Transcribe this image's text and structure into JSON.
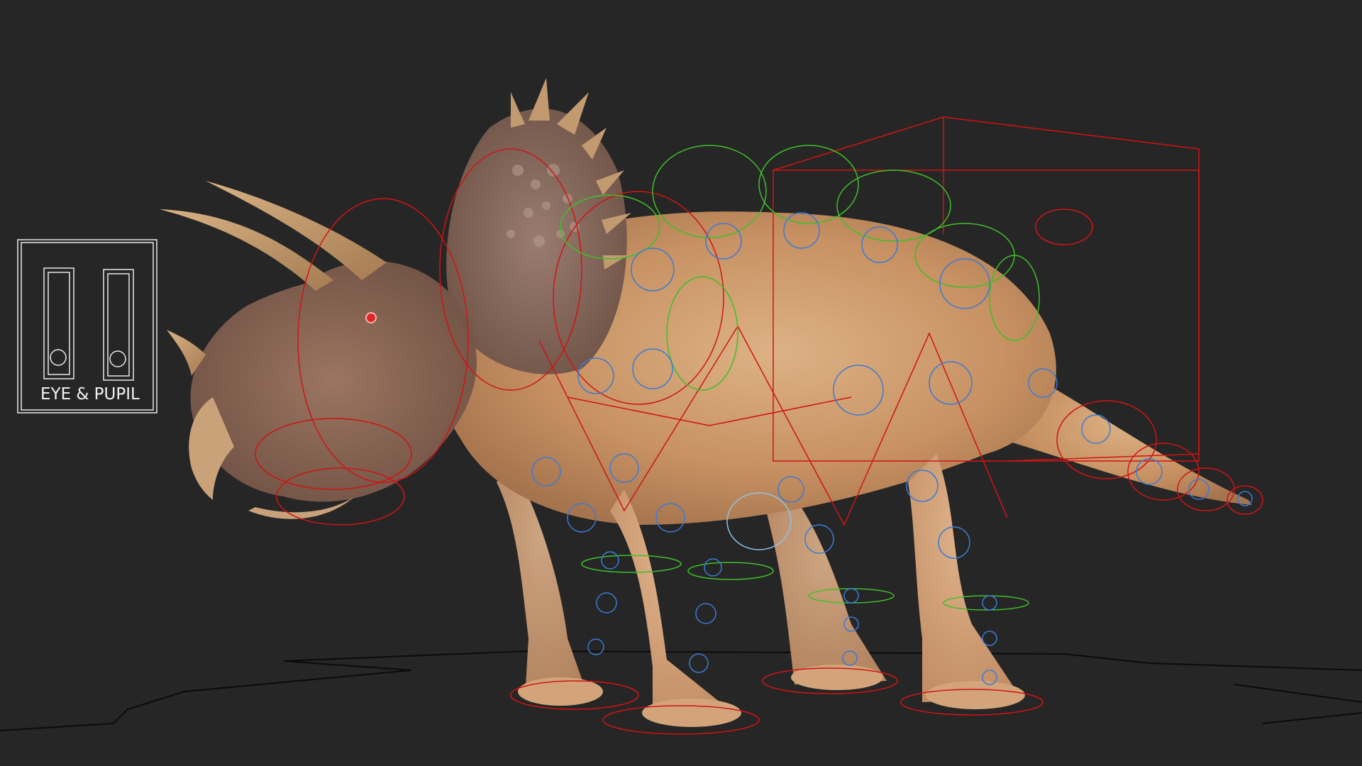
{
  "viewport": {
    "background_color": "#262626",
    "ground_line_color": "#0d0d0d",
    "rig_colors": {
      "fk_controls": "#d01414",
      "ik_controls": "#3a7bd5",
      "secondary_controls": "#3fbf2a",
      "controller_panel": "#e8e8e8"
    },
    "model": {
      "skin_light": "#d9b084",
      "skin_mid": "#c08558",
      "skin_dark": "#7d5a4a",
      "horn": "#c9a070",
      "frill": "#8a6b60"
    }
  },
  "eye_pupil_controller": {
    "label": "EYE & PUPIL",
    "icon": "eye-pupil-slider-icon"
  }
}
